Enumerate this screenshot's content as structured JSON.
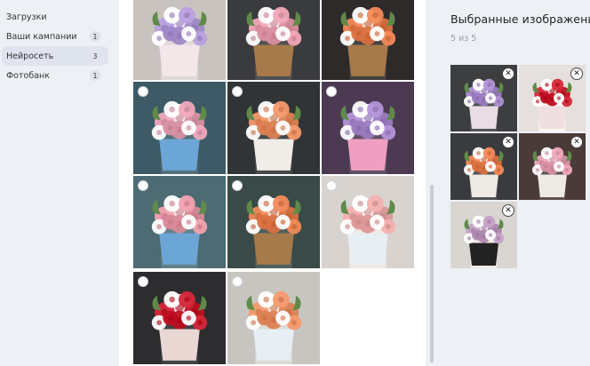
{
  "sidebar": {
    "items": [
      {
        "label": "Загрузки",
        "count": ""
      },
      {
        "label": "Ваши кампании",
        "count": "1"
      },
      {
        "label": "Нейросеть",
        "count": "3"
      },
      {
        "label": "Фотобанк",
        "count": "1"
      }
    ]
  },
  "gallery": {
    "tiles": [
      {
        "subject": "bouquet-in-hands",
        "bg": "#c9c3c0",
        "flowers": "#b9a0e0",
        "holder": "#f3e7ea",
        "checkbox": false
      },
      {
        "subject": "basket-of-flowers",
        "bg": "#3a3b3e",
        "flowers": "#f2a8b8",
        "holder": "#a67a4a",
        "checkbox": false
      },
      {
        "subject": "two-baskets",
        "bg": "#2e2a2a",
        "flowers": "#f28a5a",
        "holder": "#a67a4a",
        "checkbox": false
      },
      {
        "subject": "blue-hatbox-bouquet",
        "bg": "#3d5a66",
        "flowers": "#f0a9bd",
        "holder": "#6ba6d6",
        "checkbox": true
      },
      {
        "subject": "white-box-bouquet",
        "bg": "#313436",
        "flowers": "#f59a6d",
        "holder": "#f0ece8",
        "checkbox": true
      },
      {
        "subject": "pink-box-bouquet",
        "bg": "#4c3a52",
        "flowers": "#b394d8",
        "holder": "#ef9fc0",
        "checkbox": true
      },
      {
        "subject": "blue-hatbox-bouquet",
        "bg": "#4c6b73",
        "flowers": "#f2a2b0",
        "holder": "#6ba6d6",
        "checkbox": true
      },
      {
        "subject": "basket-in-hands",
        "bg": "#3a4a48",
        "flowers": "#f28a5a",
        "holder": "#a67a4a",
        "checkbox": true
      },
      {
        "subject": "bag-bouquet",
        "bg": "#d9d3cf",
        "flowers": "#f4b0b0",
        "holder": "#e7eef4",
        "checkbox": true
      },
      {
        "subject": "red-rose-bouquet",
        "bg": "#2d2d2f",
        "flowers": "#d6283a",
        "holder": "#e8d7d2",
        "checkbox": true
      },
      {
        "subject": "bag-bouquet",
        "bg": "#c8c5c0",
        "flowers": "#f59a6d",
        "holder": "#e7eef4",
        "checkbox": true
      }
    ]
  },
  "selected": {
    "title": "Выбранные изображения",
    "counter": "5 из 5",
    "items": [
      {
        "bg": "#3d3e40",
        "flowers": "#b394d8",
        "holder": "#eadce4"
      },
      {
        "bg": "#e5e0dd",
        "flowers": "#d6283a",
        "holder": "#f0dfe0"
      },
      {
        "bg": "#3a3b3e",
        "flowers": "#f28a5a",
        "holder": "#eeeae6"
      },
      {
        "bg": "#4a3a38",
        "flowers": "#f0a9bd",
        "holder": "#eeeae6"
      },
      {
        "bg": "#d9d6d2",
        "flowers": "#c7a0c8",
        "holder": "#222222"
      }
    ]
  },
  "colors": {
    "accent_bg": "#edf0f5",
    "active_item": "#dfe4ee"
  }
}
